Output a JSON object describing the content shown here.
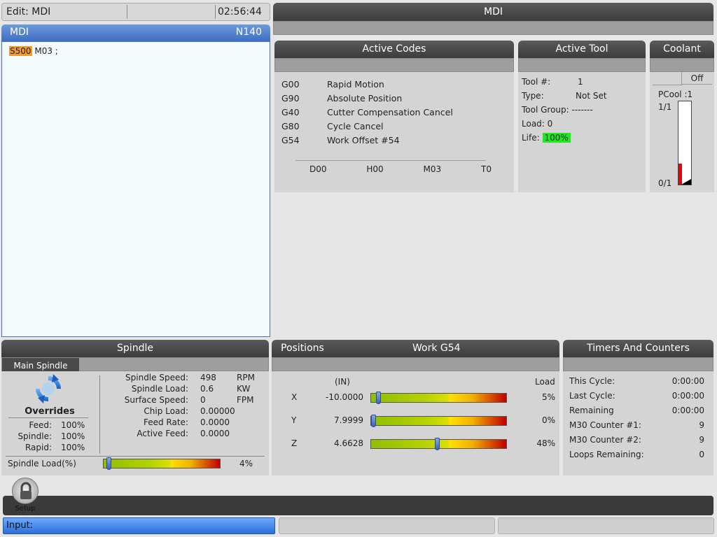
{
  "status_bar": {
    "mode_label": "Edit: MDI",
    "time": "02:56:44"
  },
  "program": {
    "title": "MDI",
    "line": "N140",
    "code_highlight": "S500",
    "code_rest": " M03 ;"
  },
  "mdi_header": "MDI",
  "active_codes": {
    "title": "Active Codes",
    "codes": [
      {
        "code": "G00",
        "desc": "Rapid Motion"
      },
      {
        "code": "G90",
        "desc": "Absolute Position"
      },
      {
        "code": "G40",
        "desc": "Cutter Compensation Cancel"
      },
      {
        "code": "G80",
        "desc": "Cycle Cancel"
      },
      {
        "code": "G54",
        "desc": "Work Offset #54"
      }
    ],
    "extra": [
      "D00",
      "H00",
      "M03",
      "T0"
    ]
  },
  "active_tool": {
    "title": "Active Tool",
    "tool_num_label": "Tool #:",
    "tool_num": "1",
    "type_label": "Type:",
    "type": "Not Set",
    "group_label": "Tool Group:",
    "group": "-------",
    "load_label": "Load: 0",
    "life_label": "Life:",
    "life": "100%"
  },
  "coolant": {
    "title": "Coolant",
    "state": "Off",
    "pcool_label": "PCool",
    "pcool_val": ":1",
    "top_label": "1/1",
    "bottom_label": "0/1",
    "fill_level": 0.25
  },
  "spindle": {
    "title": "Spindle",
    "tab": "Main Spindle",
    "overrides_label": "Overrides",
    "feed_label": "Feed:",
    "feed": "100%",
    "spindle_label": "Spindle:",
    "spindle": "100%",
    "rapid_label": "Rapid:",
    "rapid": "100%",
    "stats": [
      {
        "label": "Spindle Speed:",
        "value": "498",
        "unit": "RPM"
      },
      {
        "label": "Spindle Load:",
        "value": "0.6",
        "unit": "KW"
      },
      {
        "label": "Surface Speed:",
        "value": "0",
        "unit": "FPM"
      },
      {
        "label": "Chip Load:",
        "value": "0.00000",
        "unit": ""
      },
      {
        "label": "Feed Rate:",
        "value": "0.0000",
        "unit": ""
      },
      {
        "label": "Active Feed:",
        "value": "0.0000",
        "unit": ""
      }
    ],
    "load_label": "Spindle Load(%)",
    "load_pct": "4%",
    "load_value": 4
  },
  "positions": {
    "title": "Positions",
    "work": "Work G54",
    "unit": "(IN)",
    "load_label": "Load",
    "axes": [
      {
        "axis": "X",
        "value": "-10.0000",
        "load": "5%",
        "load_value": 5
      },
      {
        "axis": "Y",
        "value": "7.9999",
        "load": "0%",
        "load_value": 0
      },
      {
        "axis": "Z",
        "value": "4.6628",
        "load": "48%",
        "load_value": 48
      }
    ]
  },
  "timers": {
    "title": "Timers And Counters",
    "rows": [
      {
        "label": "This Cycle:",
        "value": "0:00:00"
      },
      {
        "label": "Last Cycle:",
        "value": "0:00:00"
      },
      {
        "label": "Remaining",
        "value": "0:00:00"
      },
      {
        "label": "M30 Counter #1:",
        "value": "9"
      },
      {
        "label": "M30 Counter #2:",
        "value": "9"
      },
      {
        "label": "Loops Remaining:",
        "value": "0"
      }
    ]
  },
  "setup_label": "Setup",
  "input_label": "Input:"
}
